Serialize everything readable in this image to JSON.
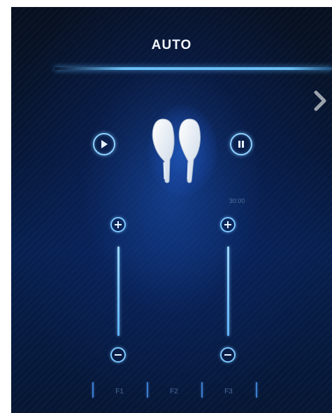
{
  "header": {
    "title": "AUTO"
  },
  "controls": {
    "play_icon": "play-icon",
    "pause_icon": "pause-icon",
    "next_icon": "chevron-right-icon"
  },
  "timer": {
    "value": "30:00"
  },
  "frequency_tabs": [
    {
      "label": "F1"
    },
    {
      "label": "F2"
    },
    {
      "label": "F3"
    }
  ],
  "sliders": {
    "left": {
      "increase_icon": "plus-icon",
      "decrease_icon": "minus-icon"
    },
    "right": {
      "increase_icon": "plus-icon",
      "decrease_icon": "minus-icon"
    }
  },
  "colors": {
    "accent": "#8fd0ff",
    "background": "#061634",
    "title": "#f2f6ff",
    "muted_text": "#4b6c9c"
  }
}
